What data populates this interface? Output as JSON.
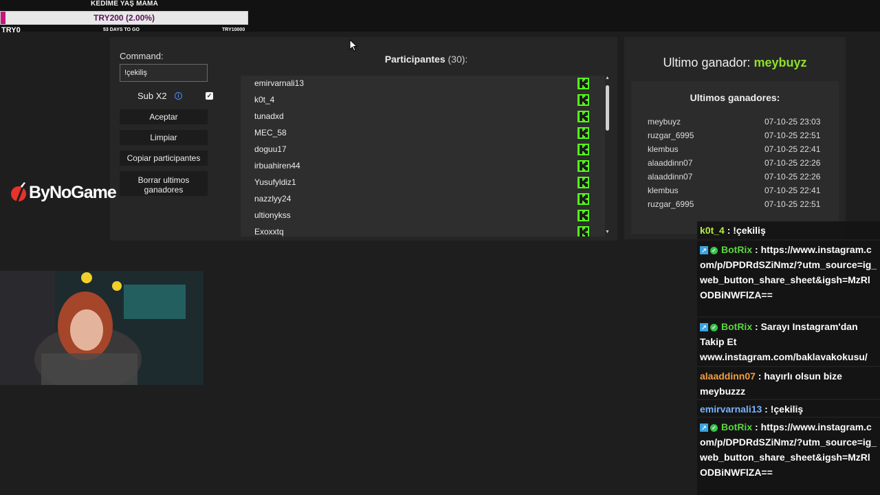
{
  "goal": {
    "title": "KEDİME YAŞ MAMA",
    "amount": "TRY200 (2.00%)",
    "progress_percent": 2,
    "left_label": "TRY0",
    "days_left": "53 DAYS TO GO",
    "right_label": "TRY10000"
  },
  "panel": {
    "command_label": "Command:",
    "command_value": "!çekiliş",
    "sub_label": "Sub X2",
    "sub_checked": true,
    "buttons": {
      "accept": "Aceptar",
      "clear": "Limpiar",
      "copy": "Copiar participantes",
      "delete": "Borrar ultimos ganadores"
    },
    "participants_title": "Participantes",
    "participants_count": "(30):",
    "participants": [
      "emirvarnali13",
      "k0t_4",
      "tunadxd",
      "MEC_58",
      "doguu17",
      "irbuahiren44",
      "Yusufyldiz1",
      "nazzlyy24",
      "ultionykss",
      "Exoxxtq"
    ]
  },
  "winner": {
    "label": "Ultimo ganador:",
    "name": "meybuyz",
    "recent_title": "Ultimos ganadores:",
    "recent": [
      {
        "name": "meybuyz",
        "time": "07-10-25 23:03"
      },
      {
        "name": "ruzgar_6995",
        "time": "07-10-25 22:51"
      },
      {
        "name": "klembus",
        "time": "07-10-25 22:41"
      },
      {
        "name": "alaaddinn07",
        "time": "07-10-25 22:26"
      },
      {
        "name": "alaaddinn07",
        "time": "07-10-25 22:26"
      },
      {
        "name": "klembus",
        "time": "07-10-25 22:41"
      },
      {
        "name": "ruzgar_6995",
        "time": "07-10-25 22:51"
      }
    ]
  },
  "logo": {
    "text": "ByNoGame"
  },
  "chat": {
    "messages": [
      {
        "user": "k0t_4",
        "text": " : !çekiliş"
      },
      {
        "user": "BotRix",
        "text": " : https://www.instagram.com/p/DPDRdSZiNmz/?utm_source=ig_web_button_share_sheet&igsh=MzRlODBiNWFlZA=="
      },
      {
        "user": "BotRix",
        "text": " : Sarayı Instagram'dan Takip Et www.instagram.com/baklavakokusu/"
      },
      {
        "user": "alaaddinn07",
        "text": " : hayırlı olsun bize meybuzzz"
      },
      {
        "user": "emirvarnali13",
        "text": " : !çekiliş"
      },
      {
        "user": "BotRix",
        "text": " : https://www.instagram.com/p/DPDRdSZiNmz/?utm_source=ig_web_button_share_sheet&igsh=MzRlODBiNWFlZA=="
      }
    ]
  },
  "colors": {
    "accent_green": "#8ee02a",
    "kick_green": "#53fc18",
    "goal_fill": "#c2187e"
  }
}
